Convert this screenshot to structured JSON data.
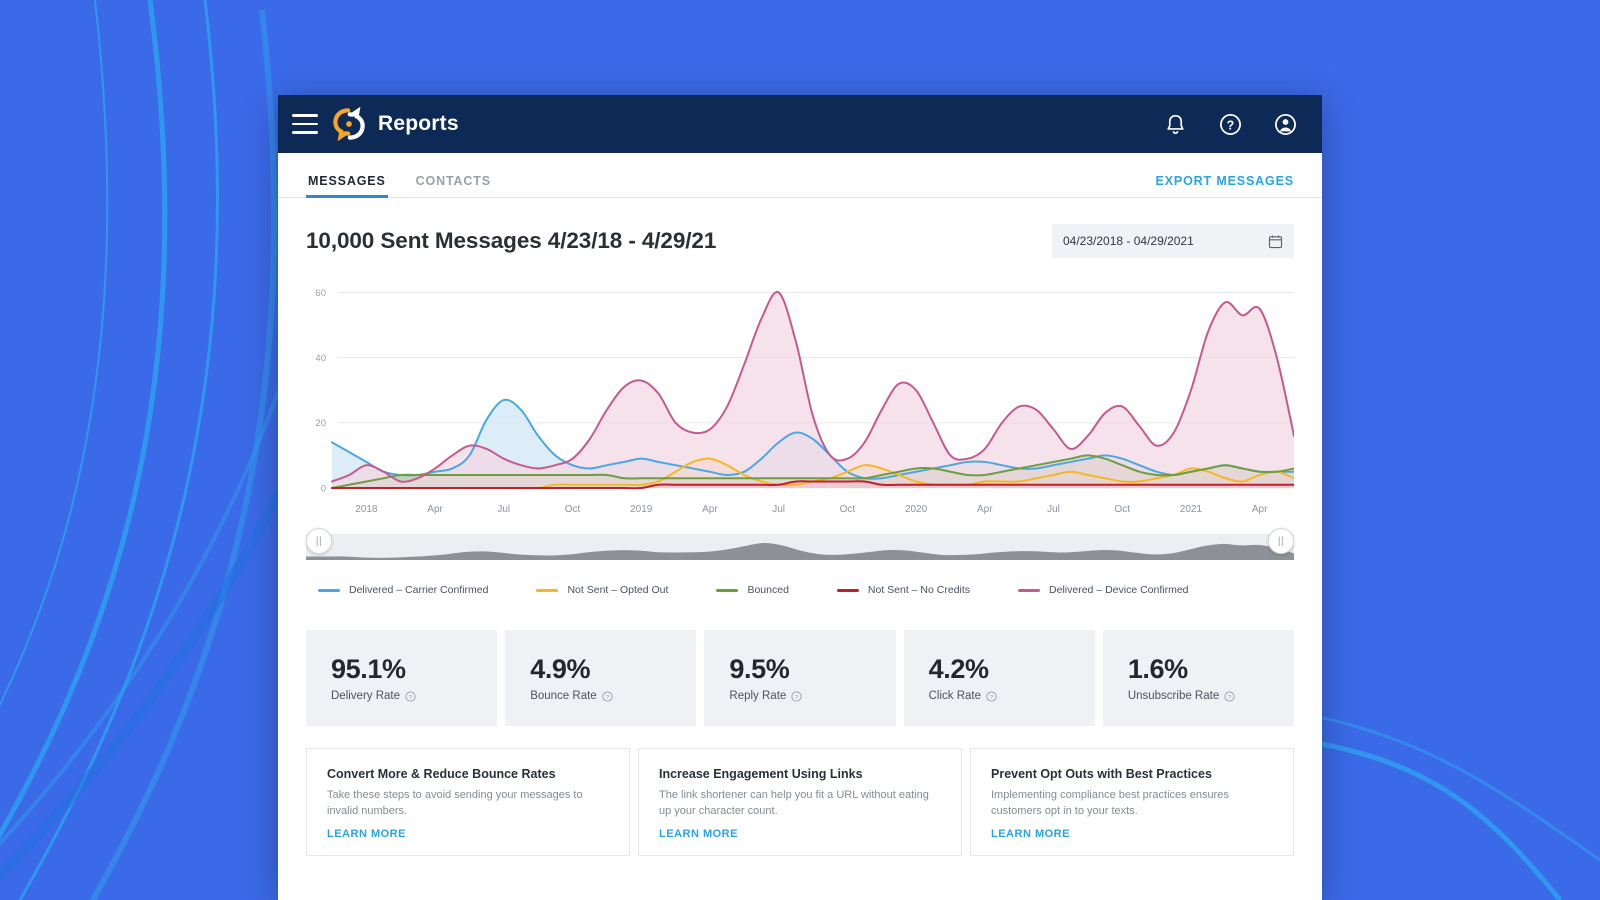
{
  "topbar": {
    "app_title": "Reports",
    "menu_icon": "hamburger-menu-icon",
    "logo_icon": "brand-logo-icon",
    "notifications_icon": "bell-icon",
    "help_icon": "question-circle-icon",
    "account_icon": "user-account-icon"
  },
  "tabs": [
    {
      "label": "MESSAGES",
      "active": true
    },
    {
      "label": "CONTACTS",
      "active": false
    }
  ],
  "export_label": "EXPORT MESSAGES",
  "header": {
    "title": "10,000 Sent Messages 4/23/18 - 4/29/21",
    "date_range_value": "04/23/2018 - 04/29/2021",
    "calendar_icon": "calendar-icon"
  },
  "brush": {
    "left_handle_grip": "||",
    "right_handle_grip": "||"
  },
  "chart_data": {
    "type": "area",
    "title": "10,000 Sent Messages 4/23/18 - 4/29/21",
    "xlabel": "",
    "ylabel": "",
    "ylim": [
      0,
      62
    ],
    "yticks": [
      0,
      20,
      40,
      60
    ],
    "grid": true,
    "legend_position": "bottom",
    "xticks": [
      "2018",
      "Apr",
      "Jul",
      "Oct",
      "2019",
      "Apr",
      "Jul",
      "Oct",
      "2020",
      "Apr",
      "Jul",
      "Oct",
      "2021",
      "Apr"
    ],
    "x": [
      0,
      1,
      2,
      3,
      4,
      5,
      6,
      7,
      8,
      9,
      10,
      11,
      12,
      13,
      14,
      15,
      16,
      17,
      18,
      19,
      20,
      21,
      22,
      23,
      24,
      25,
      26,
      27,
      28,
      29,
      30,
      31,
      32,
      33,
      34,
      35,
      36,
      37,
      38,
      39,
      40,
      41,
      42,
      43,
      44,
      45,
      46,
      47,
      48,
      49,
      50,
      51,
      52,
      53,
      54,
      55,
      56
    ],
    "series": [
      {
        "name": "Delivered – Carrier Confirmed",
        "color": "#4aa8e0",
        "fill": "#cfe6f5",
        "values": [
          14,
          11,
          8,
          5,
          4,
          4,
          5,
          6,
          10,
          21,
          27,
          24,
          16,
          10,
          7,
          6,
          7,
          8,
          9,
          8,
          7,
          6,
          5,
          4,
          5,
          9,
          14,
          17,
          15,
          10,
          5,
          3,
          3,
          4,
          5,
          6,
          7,
          8,
          8,
          7,
          6,
          6,
          7,
          8,
          9,
          10,
          9,
          7,
          5,
          4,
          5,
          6,
          7,
          6,
          5,
          5,
          5
        ]
      },
      {
        "name": "Not Sent – Opted Out",
        "color": "#f3b924",
        "fill": "#f7e2a8",
        "values": [
          0,
          0,
          0,
          0,
          0,
          0,
          0,
          0,
          0,
          0,
          0,
          0,
          0,
          1,
          1,
          1,
          1,
          1,
          1,
          2,
          5,
          8,
          9,
          7,
          4,
          2,
          1,
          1,
          2,
          3,
          5,
          7,
          6,
          4,
          2,
          1,
          1,
          1,
          2,
          2,
          2,
          3,
          4,
          5,
          4,
          3,
          2,
          2,
          3,
          4,
          6,
          5,
          3,
          2,
          4,
          5,
          3
        ]
      },
      {
        "name": "Bounced",
        "color": "#6e9e3f",
        "fill": "#b8c9a2",
        "values": [
          0,
          1,
          2,
          3,
          4,
          4,
          4,
          4,
          4,
          4,
          4,
          4,
          4,
          4,
          4,
          4,
          4,
          3,
          3,
          3,
          3,
          3,
          3,
          3,
          3,
          3,
          3,
          3,
          3,
          3,
          3,
          3,
          4,
          5,
          6,
          6,
          5,
          4,
          4,
          5,
          6,
          7,
          8,
          9,
          10,
          9,
          7,
          5,
          4,
          4,
          5,
          6,
          7,
          6,
          5,
          5,
          6
        ]
      },
      {
        "name": "Not Sent – No Credits",
        "color": "#c0202a",
        "fill": "#e3a0a3",
        "values": [
          0,
          0,
          0,
          0,
          0,
          0,
          0,
          0,
          0,
          0,
          0,
          0,
          0,
          0,
          0,
          0,
          0,
          0,
          0,
          1,
          1,
          1,
          1,
          1,
          1,
          1,
          1,
          2,
          2,
          2,
          2,
          2,
          1,
          1,
          1,
          1,
          1,
          1,
          1,
          1,
          1,
          1,
          1,
          1,
          1,
          1,
          1,
          1,
          1,
          1,
          1,
          1,
          1,
          1,
          1,
          1,
          1
        ]
      },
      {
        "name": "Delivered – Device Confirmed",
        "color": "#c55a8e",
        "fill": "#f2d7e3",
        "values": [
          2,
          4,
          7,
          5,
          2,
          3,
          6,
          10,
          13,
          12,
          9,
          7,
          6,
          7,
          9,
          15,
          24,
          31,
          33,
          29,
          20,
          17,
          18,
          25,
          38,
          52,
          60,
          45,
          22,
          10,
          9,
          14,
          24,
          32,
          30,
          20,
          10,
          9,
          12,
          20,
          25,
          24,
          18,
          12,
          16,
          23,
          25,
          19,
          13,
          17,
          30,
          48,
          57,
          53,
          55,
          40,
          16
        ]
      }
    ]
  },
  "kpis": [
    {
      "value": "95.1%",
      "label": "Delivery Rate",
      "info_icon": "info-circle-icon"
    },
    {
      "value": "4.9%",
      "label": "Bounce Rate",
      "info_icon": "info-circle-icon"
    },
    {
      "value": "9.5%",
      "label": "Reply Rate",
      "info_icon": "info-circle-icon"
    },
    {
      "value": "4.2%",
      "label": "Click Rate",
      "info_icon": "info-circle-icon"
    },
    {
      "value": "1.6%",
      "label": "Unsubscribe Rate",
      "info_icon": "info-circle-icon"
    }
  ],
  "tips": [
    {
      "title": "Convert More & Reduce Bounce Rates",
      "body": "Take these steps to avoid sending your messages to invalid numbers.",
      "link": "LEARN MORE"
    },
    {
      "title": "Increase Engagement Using Links",
      "body": "The link shortener can help you fit a URL without eating up your character count.",
      "link": "LEARN MORE"
    },
    {
      "title": "Prevent Opt Outs with Best Practices",
      "body": "Implementing compliance best practices ensures customers opt in to your texts.",
      "link": "LEARN MORE"
    }
  ],
  "colors": {
    "brand_navy": "#0d2a56",
    "brand_orange": "#f5a623",
    "accent_blue": "#2aa3e8",
    "page_bg": "#3b6ae8"
  }
}
